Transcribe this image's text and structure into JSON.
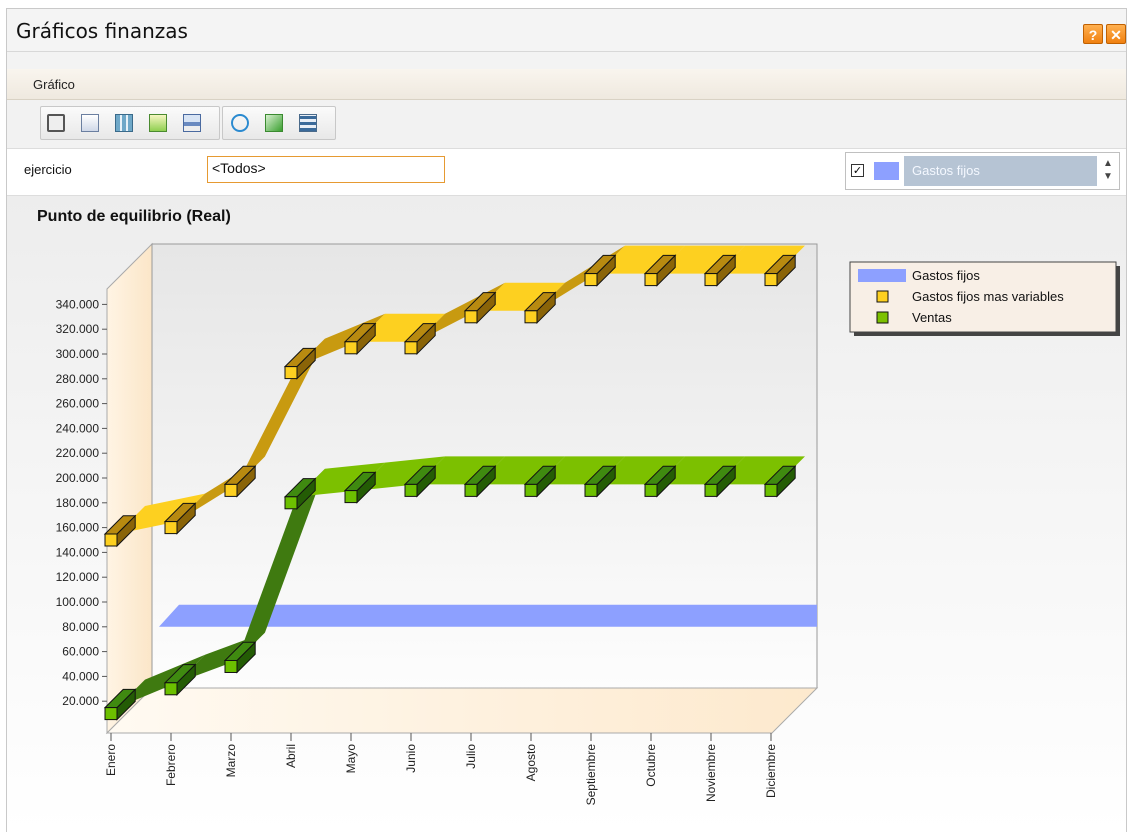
{
  "window": {
    "title": "Gráficos finanzas",
    "help_button": "?",
    "close_button": "✕"
  },
  "menu": {
    "grafico_label": "Gráfico"
  },
  "toolbar": {
    "icons": [
      "window-icon",
      "copy-icon",
      "table-icon",
      "excel-icon",
      "print-icon",
      "refresh-icon",
      "export-icon",
      "swap-icon"
    ]
  },
  "filter": {
    "label": "ejercicio",
    "value": "<Todos>"
  },
  "series_selector": {
    "checked": true,
    "selected": "Gastos fijos",
    "color": "#8da0ff"
  },
  "chart_data": {
    "type": "line",
    "title": "Punto de equilibrio (Real)",
    "categories": [
      "Enero",
      "Febrero",
      "Marzo",
      "Abril",
      "Mayo",
      "Junio",
      "Julio",
      "Agosto",
      "Septiembre",
      "Octubre",
      "Noviembre",
      "Diciembre"
    ],
    "series": [
      {
        "name": "Gastos fijos",
        "type": "area-band",
        "color": "#8da0ff",
        "values": [
          80000,
          80000,
          80000,
          80000,
          80000,
          80000,
          80000,
          80000,
          80000,
          80000,
          80000,
          80000
        ]
      },
      {
        "name": "Gastos fijos mas variables",
        "color": "#fdd020",
        "values": [
          150000,
          160000,
          190000,
          285000,
          305000,
          305000,
          330000,
          330000,
          360000,
          360000,
          360000,
          360000
        ]
      },
      {
        "name": "Ventas",
        "color": "#7cc000",
        "values": [
          10000,
          30000,
          48000,
          180000,
          185000,
          190000,
          190000,
          190000,
          190000,
          190000,
          190000,
          190000
        ]
      }
    ],
    "yticks": [
      20000,
      40000,
      60000,
      80000,
      100000,
      120000,
      140000,
      160000,
      180000,
      200000,
      220000,
      240000,
      260000,
      280000,
      300000,
      320000,
      340000
    ],
    "ytick_labels": [
      "20.000",
      "40.000",
      "60.000",
      "80.000",
      "100.000",
      "120.000",
      "140.000",
      "160.000",
      "180.000",
      "200.000",
      "220.000",
      "240.000",
      "260.000",
      "280.000",
      "300.000",
      "320.000",
      "340.000"
    ],
    "legend_position": "right",
    "style": "3d"
  }
}
